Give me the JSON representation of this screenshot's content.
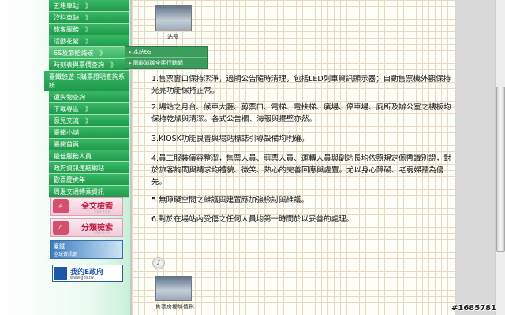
{
  "sidebar": {
    "items": [
      {
        "label": "五堵車站"
      },
      {
        "label": "汐科車站"
      },
      {
        "label": "旅客服務"
      },
      {
        "label": "活動花絮"
      },
      {
        "label": "6S及節能減碳"
      },
      {
        "label": "時刻表與票價查詢"
      },
      {
        "label": "臺鐵悠遊卡購票證明查詢系統"
      },
      {
        "label": "遺失物查詢"
      },
      {
        "label": "下載專區"
      },
      {
        "label": "意見交流"
      },
      {
        "label": "臺鐵小舖"
      },
      {
        "label": "臺鐵首頁"
      },
      {
        "label": "最佳服務人員"
      },
      {
        "label": "政府資訊連結網站"
      },
      {
        "label": "歡喜慶虎年"
      },
      {
        "label": "周邊交通轉乘資訊"
      }
    ],
    "chevron": "》",
    "fulltext_search": {
      "label": "全文檢索",
      "sub": "SEARCH"
    },
    "category_search": {
      "label": "分類檢索",
      "sub": "SEARCH"
    },
    "train_banner": {
      "line1": "臺鐵",
      "line2": "全球資訊網"
    },
    "egov_banner": {
      "line1": "我的E政府",
      "line2": "www.gov.tw"
    }
  },
  "submenu": {
    "items": [
      {
        "label": "▸ 本站6S"
      },
      {
        "label": "▸ 節能減碳全民行動網"
      }
    ]
  },
  "content": {
    "top_photo_caption": "站長",
    "rules": [
      "1.售票窗口保持潔淨，過期公告隨時清理，包括LED列車資訊顯示器；自動售票機外觀保持光亮功能保持正常。",
      "2.場站之月台、候車大廳、剪票口、電梯、電扶梯、廣場、停車場、廁所及辦公室之樓板均保持乾燥與清潔。各式公告欄、海報與擺壁亦然。",
      "3.KIOSK功能良善與場站標誌引導設備均明確。",
      "4.員工服裝儀容整潔，售票人員、剪票人員、運轉人員與副站長均依照規定佩帶識別證，對於旅客詢問與請求均禮貌、微笑、熱心的完善回應與處置。尤以身心障礙、老弱婦孺為優先。",
      "5.無障礙空間之維護與建置應加強檢討與維護。",
      "6.對於在場站內受傷之任何人員均第一時間於以妥善的處理。"
    ],
    "bottom_photo_caption": "售票房擺設情形"
  },
  "watermark": "#1685781"
}
